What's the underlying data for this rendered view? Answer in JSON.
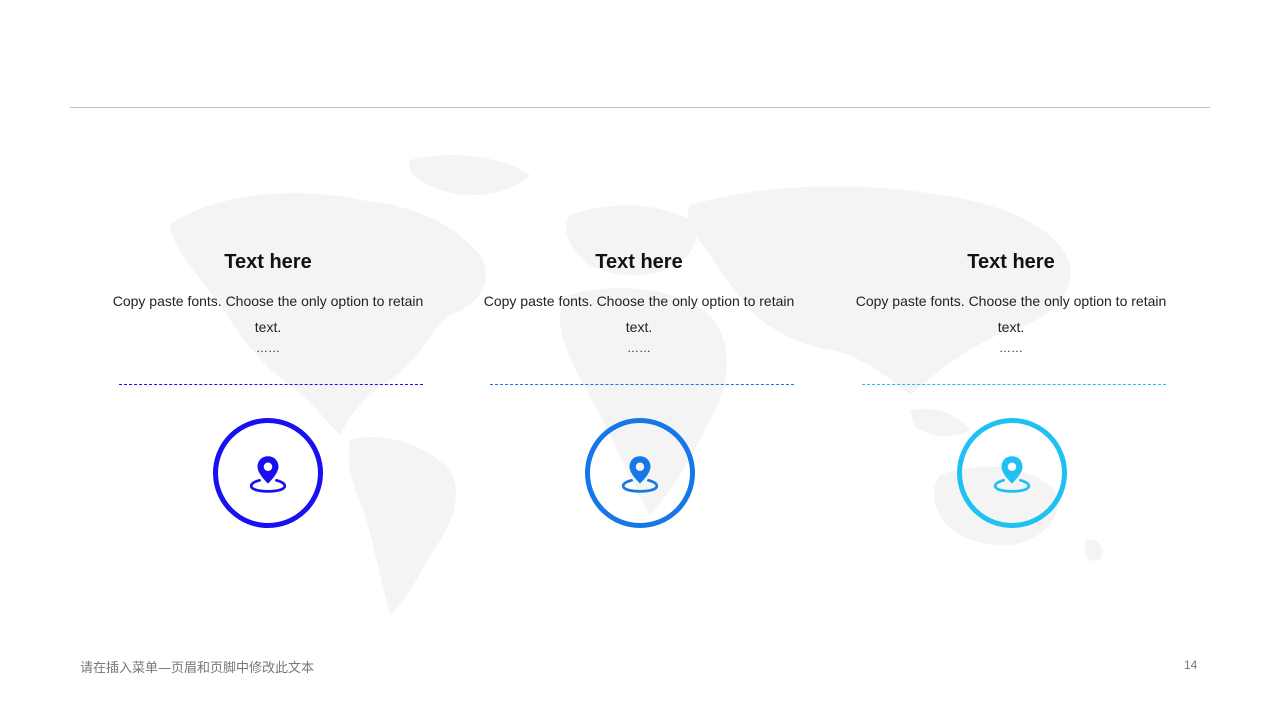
{
  "columns": [
    {
      "title": "Text here",
      "body": "Copy paste fonts. Choose the only option to retain text.",
      "dots": "……",
      "color": "#1a0ff0",
      "icon": "location-pin-icon"
    },
    {
      "title": "Text here",
      "body": "Copy paste fonts. Choose the only option to retain text.",
      "dots": "……",
      "color": "#1677e6",
      "icon": "location-pin-icon"
    },
    {
      "title": "Text here",
      "body": "Copy paste fonts. Choose the only option to retain text.",
      "dots": "……",
      "color": "#1fc1f3",
      "icon": "location-pin-icon"
    }
  ],
  "footer": {
    "text": "请在插入菜单—页眉和页脚中修改此文本",
    "page_number": "14"
  },
  "colors": {
    "rule": "#bfbfbf",
    "map": "#f2f2f2"
  }
}
